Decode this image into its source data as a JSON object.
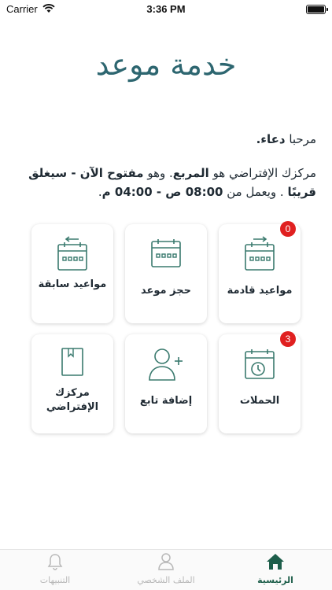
{
  "status_bar": {
    "carrier": "Carrier",
    "time": "3:36 PM"
  },
  "app_title": "خدمة موعد",
  "greeting": {
    "prefix": "مرحبا",
    "name": "دعاء."
  },
  "center_info": {
    "part1": "مركزك الإفتراضي هو ",
    "center_name": "المربع",
    "part2": ". وهو ",
    "open_status": "مفتوح الآن - سيغلق قريبًا",
    "part3": " . ويعمل من ",
    "hours": "08:00 ص - 04:00 م",
    "part4": "."
  },
  "tiles": [
    {
      "label": "مواعيد قادمة",
      "icon": "upcoming-calendar-icon",
      "badge": "0"
    },
    {
      "label": "حجز موعد",
      "icon": "calendar-icon"
    },
    {
      "label": "مواعيد سابقة",
      "icon": "past-calendar-icon"
    },
    {
      "label": "الحملات",
      "icon": "calendar-clock-icon",
      "badge": "3"
    },
    {
      "label": "إضافة تابع",
      "icon": "add-user-icon"
    },
    {
      "label": "مركزك الإفتراضي",
      "icon": "book-icon"
    }
  ],
  "tabbar": {
    "home": "الرئيسية",
    "profile": "الملف الشخصي",
    "notifications": "التنبيهات"
  },
  "colors": {
    "primary": "#2d6670",
    "icon_green": "#3a7a6e",
    "badge": "#e02020",
    "tab_active": "#1d5e4a"
  }
}
